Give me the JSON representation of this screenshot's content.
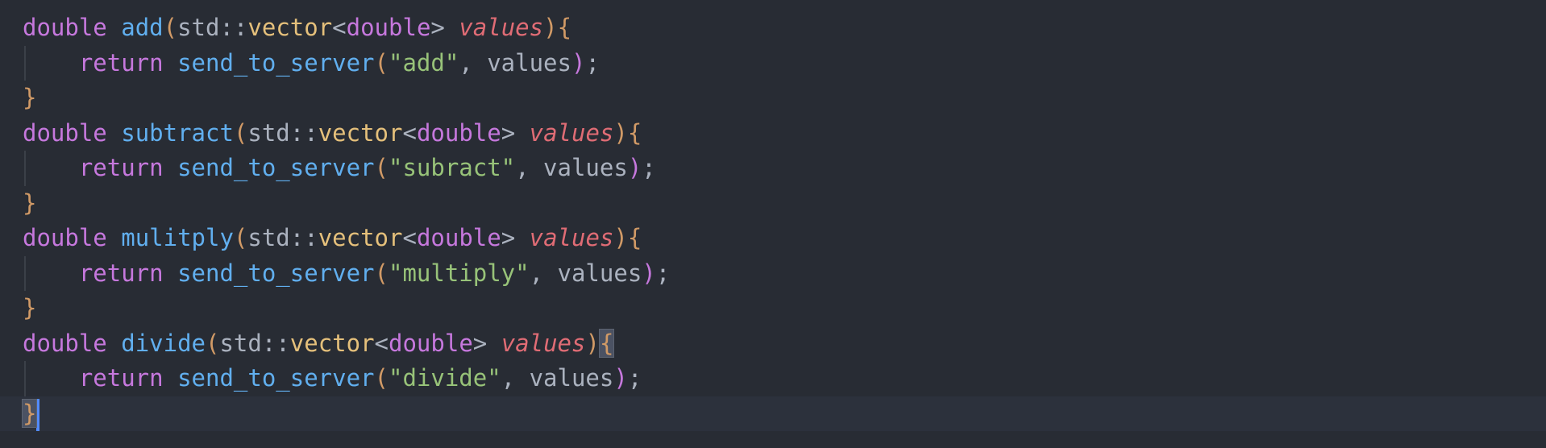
{
  "code": {
    "lines": [
      {
        "tokens": [
          "double",
          " ",
          "add",
          "(",
          "std::",
          "vector",
          "<",
          "double",
          ">",
          " ",
          "values",
          ")",
          "{"
        ]
      },
      {
        "tokens": [
          "    ",
          "return",
          " ",
          "send_to_server",
          "(",
          "\"add\"",
          ", ",
          "values",
          ")",
          ";"
        ]
      },
      {
        "tokens": [
          "}"
        ]
      },
      {
        "tokens": [
          "double",
          " ",
          "subtract",
          "(",
          "std::",
          "vector",
          "<",
          "double",
          ">",
          " ",
          "values",
          ")",
          "{"
        ]
      },
      {
        "tokens": [
          "    ",
          "return",
          " ",
          "send_to_server",
          "(",
          "\"subract\"",
          ", ",
          "values",
          ")",
          ";"
        ]
      },
      {
        "tokens": [
          "}"
        ]
      },
      {
        "tokens": [
          "double",
          " ",
          "mulitply",
          "(",
          "std::",
          "vector",
          "<",
          "double",
          ">",
          " ",
          "values",
          ")",
          "{"
        ]
      },
      {
        "tokens": [
          "    ",
          "return",
          " ",
          "send_to_server",
          "(",
          "\"multiply\"",
          ", ",
          "values",
          ")",
          ";"
        ]
      },
      {
        "tokens": [
          "}"
        ]
      },
      {
        "tokens": [
          "double",
          " ",
          "divide",
          "(",
          "std::",
          "vector",
          "<",
          "double",
          ">",
          " ",
          "values",
          ")",
          "{"
        ]
      },
      {
        "tokens": [
          "    ",
          "return",
          " ",
          "send_to_server",
          "(",
          "\"divide\"",
          ", ",
          "values",
          ")",
          ";"
        ]
      },
      {
        "tokens": [
          "}"
        ]
      }
    ]
  },
  "colors": {
    "background": "#282c34",
    "active_line": "#2c313c",
    "keyword": "#c678dd",
    "function": "#61afef",
    "type": "#e5c07b",
    "string": "#98c379",
    "parameter": "#e06c75",
    "brace": "#d19a66",
    "plain": "#abb2bf",
    "cursor": "#528bff"
  }
}
